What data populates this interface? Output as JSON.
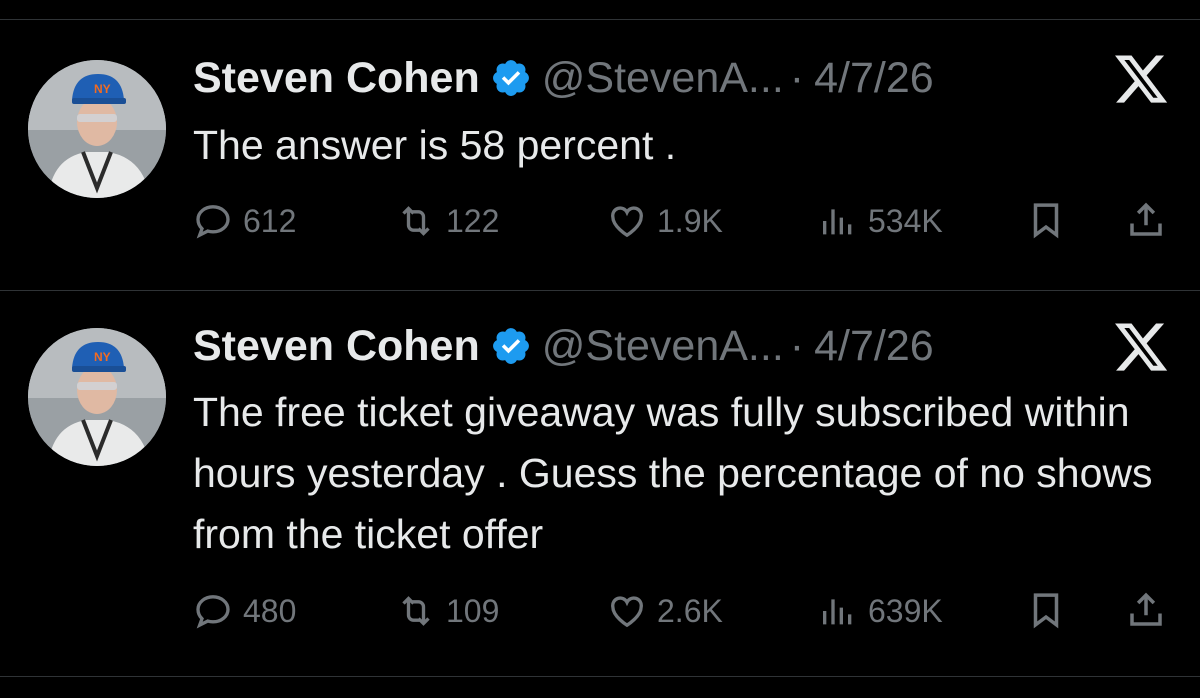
{
  "colors": {
    "background": "#000000",
    "text": "#e7e9ea",
    "muted": "#71767b",
    "verified": "#1d9bf0",
    "divider": "#2f3336"
  },
  "tweets": [
    {
      "author": {
        "name": "Steven Cohen",
        "handle": "@StevenA...",
        "verified": true
      },
      "separator": "·",
      "date": "4/7/26",
      "text": "The answer is  58 percent .",
      "metrics": {
        "replies": "612",
        "reposts": "122",
        "likes": "1.9K",
        "views": "534K"
      }
    },
    {
      "author": {
        "name": "Steven Cohen",
        "handle": "@StevenA...",
        "verified": true
      },
      "separator": "·",
      "date": "4/7/26",
      "text": "The free ticket giveaway was fully subscribed within hours yesterday . Guess the percentage of no shows from the ticket offer",
      "metrics": {
        "replies": "480",
        "reposts": "109",
        "likes": "2.6K",
        "views": "639K"
      }
    }
  ],
  "icons": [
    "reply-icon",
    "repost-icon",
    "like-icon",
    "views-icon",
    "bookmark-icon",
    "share-icon",
    "x-logo-icon",
    "verified-badge-icon"
  ]
}
